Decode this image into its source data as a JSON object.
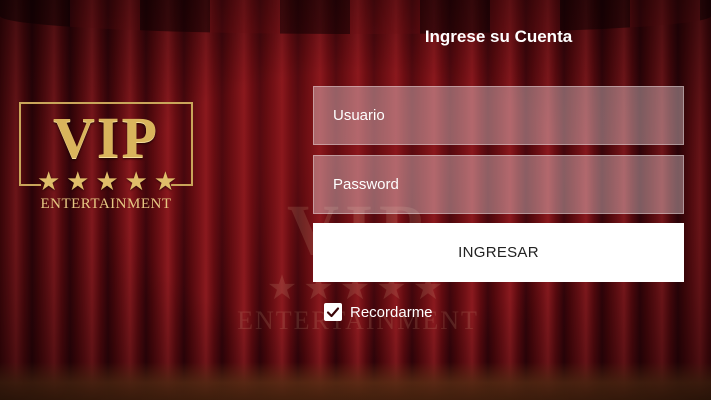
{
  "logo": {
    "brand": "VIP",
    "stars": [
      "★",
      "★",
      "★",
      "★",
      "★"
    ],
    "subtitle": "ENTERTAINMENT",
    "accent_color": "#d9b45c"
  },
  "form": {
    "title": "Ingrese su Cuenta",
    "username": {
      "value": "",
      "placeholder": "Usuario"
    },
    "password": {
      "value": "",
      "placeholder": "Password"
    },
    "submit_label": "INGRESAR",
    "remember": {
      "label": "Recordarme",
      "checked": true
    }
  }
}
